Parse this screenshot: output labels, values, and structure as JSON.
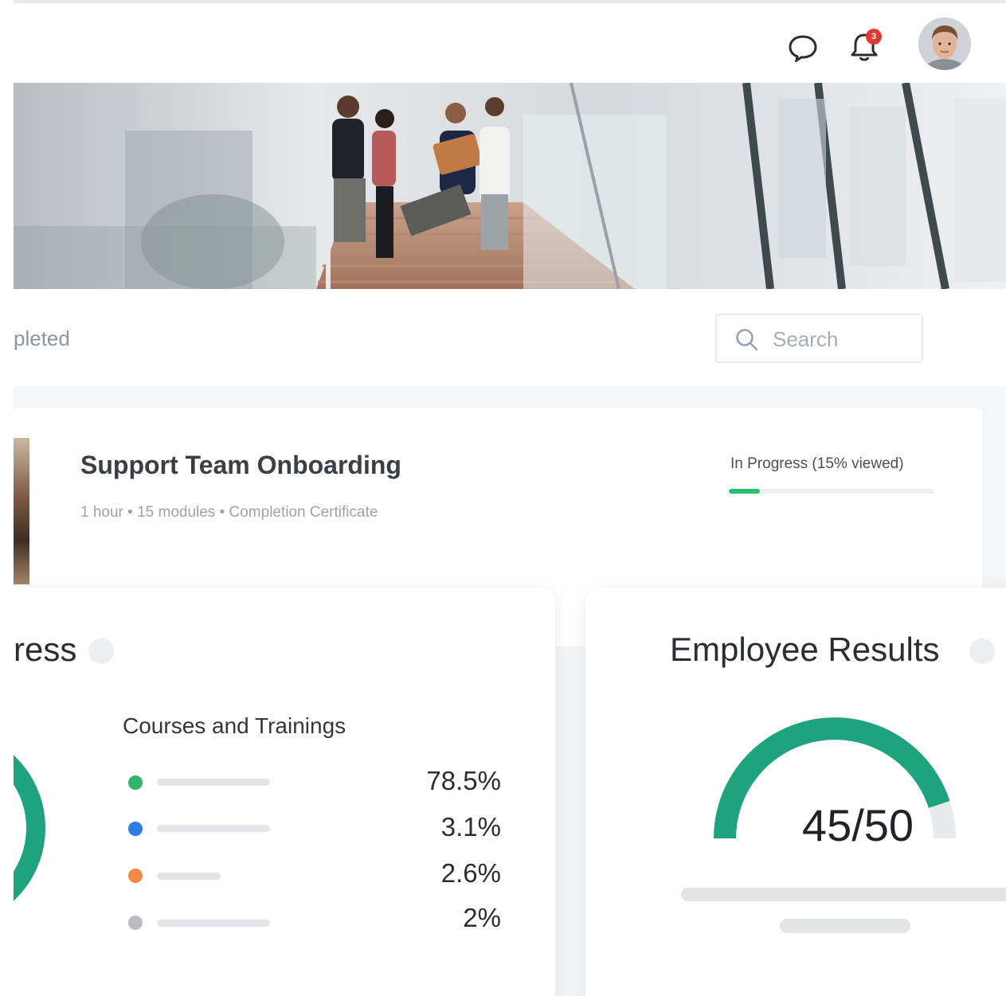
{
  "header": {
    "chat_icon": "chat-bubble-icon",
    "bell_icon": "bell-icon",
    "notification_count": "3"
  },
  "filters": {
    "tab_completed": "pleted",
    "search_placeholder": "Search"
  },
  "course": {
    "title": "Support Team Onboarding",
    "meta": "1 hour  •  15 modules  •  Completion Certificate",
    "status": "In Progress (15% viewed)",
    "progress_fraction": 0.15
  },
  "progress_panel": {
    "title": "ress",
    "donut_value_fragment": "",
    "legend_title": "Courses and Trainings",
    "items": [
      {
        "color": "#34b36a",
        "value": "78.5%"
      },
      {
        "color": "#2f7de1",
        "value": "3.1%"
      },
      {
        "color": "#f48a4a",
        "value": "2.6%"
      },
      {
        "color": "#b9bcc0",
        "value": "2%"
      }
    ]
  },
  "results_panel": {
    "title": "Employee Results",
    "score": "45/50",
    "score_fraction": 0.9
  },
  "colors": {
    "accent": "#1fa37f",
    "progress": "#2dbd6e"
  }
}
